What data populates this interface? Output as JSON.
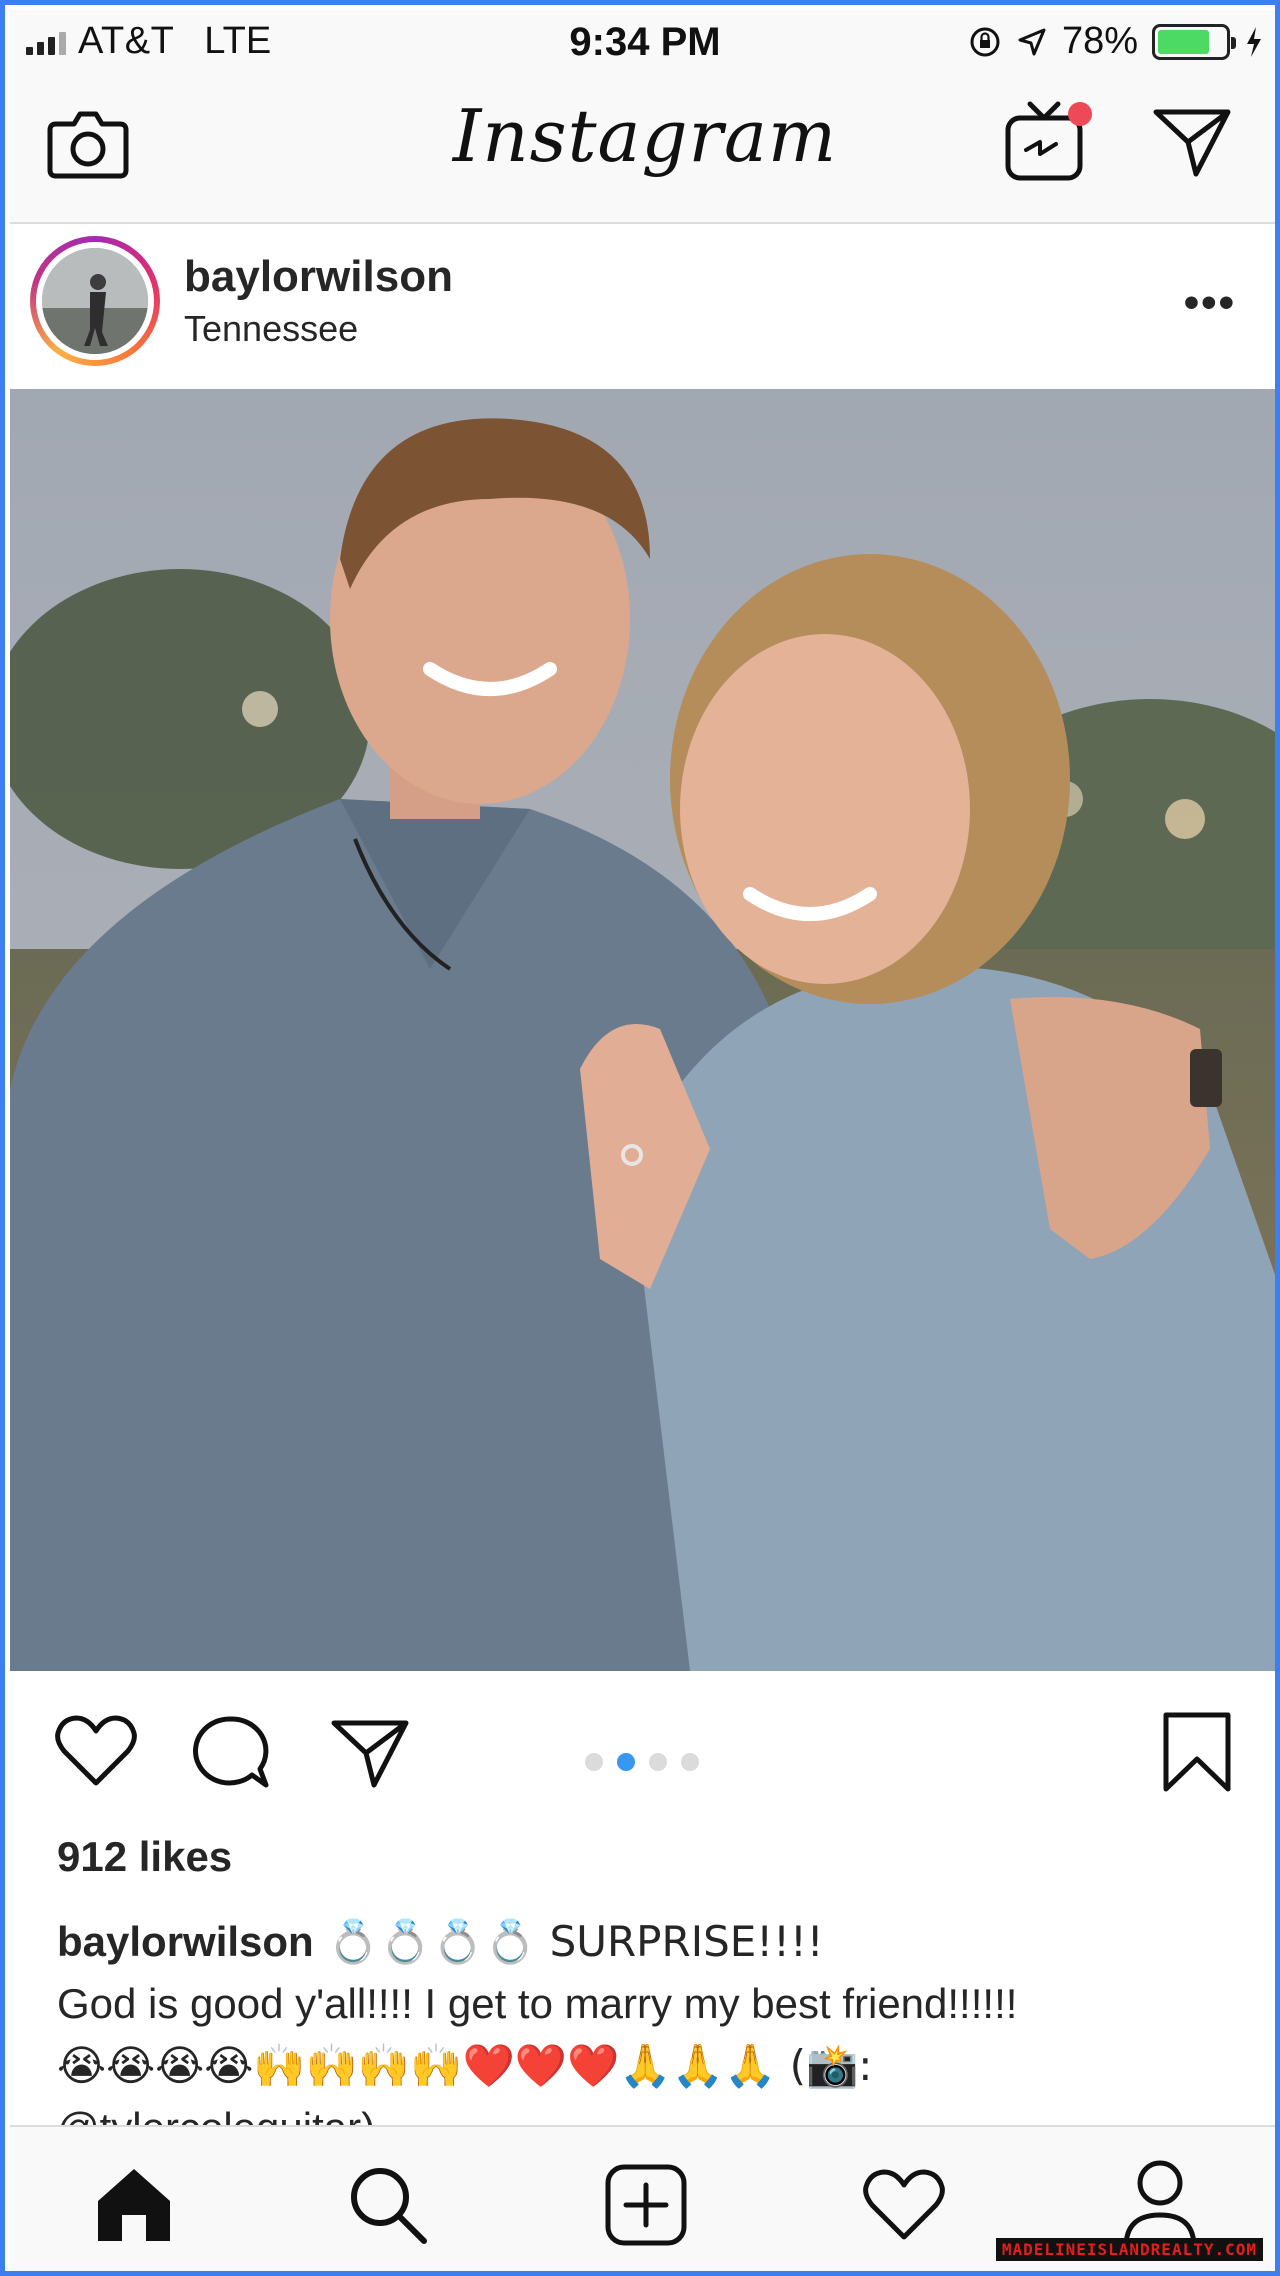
{
  "status_bar": {
    "carrier": "AT&T",
    "network": "LTE",
    "time": "9:34 PM",
    "battery_percent": "78%",
    "battery_level": 0.78,
    "battery_color": "#4cd964"
  },
  "header": {
    "logo": "Instagram",
    "left_icon": "camera-icon",
    "right_icons": [
      "igtv-icon",
      "direct-message-icon"
    ],
    "igtv_badge_color": "#ed4956"
  },
  "post": {
    "username": "baylorwilson",
    "location": "Tennessee",
    "more_label": "•••",
    "carousel": {
      "count": 4,
      "active_index": 1,
      "active_color": "#3897f0"
    },
    "likes": "912 likes",
    "caption": {
      "username": "baylorwilson",
      "line1_text": " 💍💍💍💍 SURPRISE!!!!",
      "line2": "God is good y'all!!!! I get to marry my best friend!!!!!!",
      "line3": "😭😭😭😭🙌🙌🙌🙌❤️❤️❤️🙏🙏🙏 (📸:",
      "line4": "@tylercoleguitar)"
    }
  },
  "tab_bar": {
    "items": [
      "home-icon",
      "search-icon",
      "new-post-icon",
      "activity-icon",
      "profile-icon"
    ]
  },
  "watermark": "MADELINEISLANDREALTY.COM"
}
